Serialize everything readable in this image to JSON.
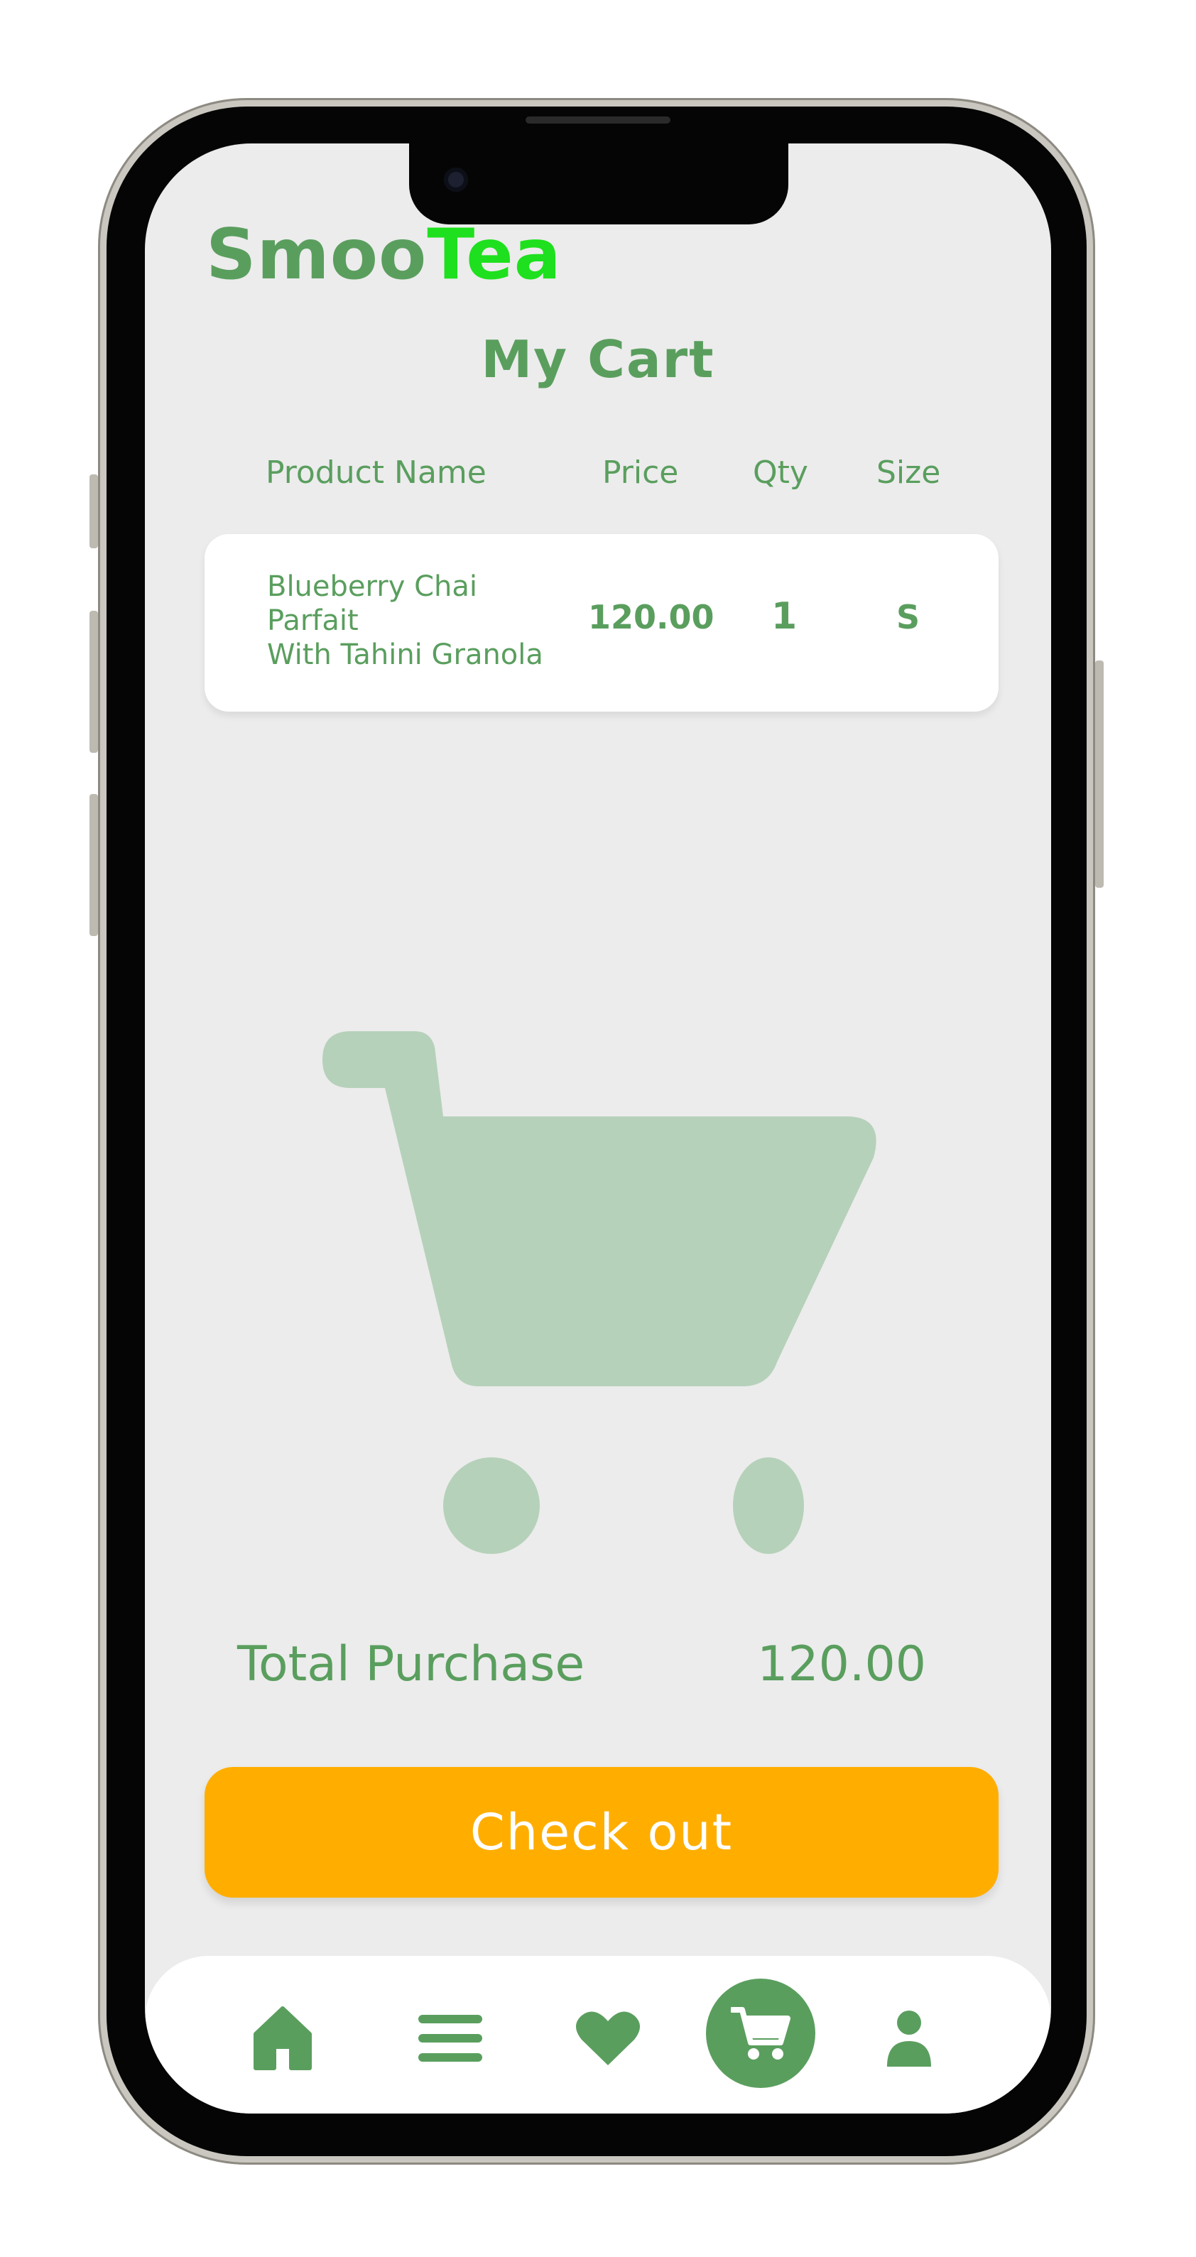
{
  "app": {
    "brand_part1": "Smoo",
    "brand_part2": "Tea",
    "accent_color": "#5a9e5e",
    "brand_highlight_color": "#1ee01e",
    "cta_color": "#ffae00"
  },
  "page": {
    "title": "My Cart"
  },
  "columns": {
    "product": "Product Name",
    "price": "Price",
    "qty": "Qty",
    "size": "Size"
  },
  "cart_items": [
    {
      "name_line1": "Blueberry Chai",
      "name_line2": "Parfait",
      "name_line3": "With Tahini Granola",
      "price": "120.00",
      "qty": "1",
      "size": "S"
    }
  ],
  "summary": {
    "total_label": "Total Purchase",
    "total_value": "120.00"
  },
  "checkout_button": {
    "label": "Check out"
  },
  "nav": [
    {
      "id": "home",
      "icon": "home-icon",
      "active": false
    },
    {
      "id": "menu",
      "icon": "menu-icon",
      "active": false
    },
    {
      "id": "favorites",
      "icon": "heart-icon",
      "active": false
    },
    {
      "id": "cart",
      "icon": "cart-icon",
      "active": true
    },
    {
      "id": "profile",
      "icon": "user-icon",
      "active": false
    }
  ]
}
